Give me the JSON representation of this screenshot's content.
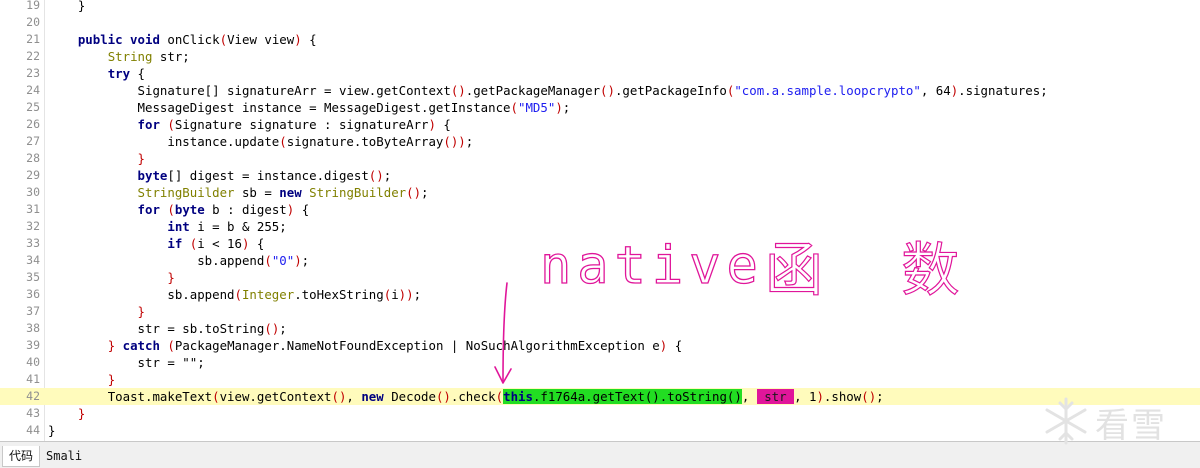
{
  "editor": {
    "lines": [
      {
        "n": "19",
        "indent": "    ",
        "tokens": [
          {
            "t": "}"
          }
        ]
      },
      {
        "n": "20",
        "indent": "",
        "tokens": []
      },
      {
        "n": "21",
        "indent": "    ",
        "tokens": [
          {
            "t": "public void",
            "c": "kw"
          },
          {
            "t": " onClick"
          },
          {
            "t": "(",
            "c": "br"
          },
          {
            "t": "View view"
          },
          {
            "t": ")",
            "c": "br"
          },
          {
            "t": " {"
          }
        ]
      },
      {
        "n": "22",
        "indent": "        ",
        "tokens": [
          {
            "t": "String",
            "c": "ty"
          },
          {
            "t": " str;"
          }
        ]
      },
      {
        "n": "23",
        "indent": "        ",
        "tokens": [
          {
            "t": "try",
            "c": "kw"
          },
          {
            "t": " {"
          }
        ]
      },
      {
        "n": "24",
        "indent": "            ",
        "tokens": [
          {
            "t": "Signature[] signatureArr = view.getContext"
          },
          {
            "t": "()",
            "c": "br"
          },
          {
            "t": ".getPackageManager"
          },
          {
            "t": "()",
            "c": "br"
          },
          {
            "t": ".getPackageInfo"
          },
          {
            "t": "(",
            "c": "br"
          },
          {
            "t": "\"com.a.sample.loopcrypto\"",
            "c": "st"
          },
          {
            "t": ", 64"
          },
          {
            "t": ")",
            "c": "br"
          },
          {
            "t": ".signatures;"
          }
        ]
      },
      {
        "n": "25",
        "indent": "            ",
        "tokens": [
          {
            "t": "MessageDigest instance = MessageDigest.getInstance"
          },
          {
            "t": "(",
            "c": "br"
          },
          {
            "t": "\"MD5\"",
            "c": "st"
          },
          {
            "t": ")",
            "c": "br"
          },
          {
            "t": ";"
          }
        ]
      },
      {
        "n": "26",
        "indent": "            ",
        "tokens": [
          {
            "t": "for",
            "c": "kw"
          },
          {
            "t": " "
          },
          {
            "t": "(",
            "c": "br"
          },
          {
            "t": "Signature signature : signatureArr"
          },
          {
            "t": ")",
            "c": "br"
          },
          {
            "t": " {"
          }
        ]
      },
      {
        "n": "27",
        "indent": "                ",
        "tokens": [
          {
            "t": "instance.update"
          },
          {
            "t": "(",
            "c": "br"
          },
          {
            "t": "signature.toByteArray"
          },
          {
            "t": "())",
            "c": "br"
          },
          {
            "t": ";"
          }
        ]
      },
      {
        "n": "28",
        "indent": "            ",
        "tokens": [
          {
            "t": "}",
            "c": "br"
          }
        ]
      },
      {
        "n": "29",
        "indent": "            ",
        "tokens": [
          {
            "t": "byte",
            "c": "kw"
          },
          {
            "t": "[] digest = instance.digest"
          },
          {
            "t": "()",
            "c": "br"
          },
          {
            "t": ";"
          }
        ]
      },
      {
        "n": "30",
        "indent": "            ",
        "tokens": [
          {
            "t": "StringBuilder",
            "c": "ty"
          },
          {
            "t": " sb = "
          },
          {
            "t": "new",
            "c": "kw"
          },
          {
            "t": " "
          },
          {
            "t": "StringBuilder",
            "c": "ty"
          },
          {
            "t": "()",
            "c": "br"
          },
          {
            "t": ";"
          }
        ]
      },
      {
        "n": "31",
        "indent": "            ",
        "tokens": [
          {
            "t": "for",
            "c": "kw"
          },
          {
            "t": " "
          },
          {
            "t": "(",
            "c": "br"
          },
          {
            "t": "byte",
            "c": "kw"
          },
          {
            "t": " b : digest"
          },
          {
            "t": ")",
            "c": "br"
          },
          {
            "t": " {"
          }
        ]
      },
      {
        "n": "32",
        "indent": "                ",
        "tokens": [
          {
            "t": "int",
            "c": "kw"
          },
          {
            "t": " i = b & 255;"
          }
        ]
      },
      {
        "n": "33",
        "indent": "                ",
        "tokens": [
          {
            "t": "if",
            "c": "kw"
          },
          {
            "t": " "
          },
          {
            "t": "(",
            "c": "br"
          },
          {
            "t": "i < 16"
          },
          {
            "t": ")",
            "c": "br"
          },
          {
            "t": " {"
          }
        ]
      },
      {
        "n": "34",
        "indent": "                    ",
        "tokens": [
          {
            "t": "sb.append"
          },
          {
            "t": "(",
            "c": "br"
          },
          {
            "t": "\"0\"",
            "c": "st"
          },
          {
            "t": ")",
            "c": "br"
          },
          {
            "t": ";"
          }
        ]
      },
      {
        "n": "35",
        "indent": "                ",
        "tokens": [
          {
            "t": "}",
            "c": "br"
          }
        ]
      },
      {
        "n": "36",
        "indent": "                ",
        "tokens": [
          {
            "t": "sb.append"
          },
          {
            "t": "(",
            "c": "br"
          },
          {
            "t": "Integer",
            "c": "ty"
          },
          {
            "t": ".toHexString"
          },
          {
            "t": "(",
            "c": "br"
          },
          {
            "t": "i"
          },
          {
            "t": "))",
            "c": "br"
          },
          {
            "t": ";"
          }
        ]
      },
      {
        "n": "37",
        "indent": "            ",
        "tokens": [
          {
            "t": "}",
            "c": "br"
          }
        ]
      },
      {
        "n": "38",
        "indent": "            ",
        "tokens": [
          {
            "t": "str = sb.toString"
          },
          {
            "t": "()",
            "c": "br"
          },
          {
            "t": ";"
          }
        ]
      },
      {
        "n": "39",
        "indent": "        ",
        "tokens": [
          {
            "t": "}",
            "c": "br"
          },
          {
            "t": " "
          },
          {
            "t": "catch",
            "c": "kw"
          },
          {
            "t": " "
          },
          {
            "t": "(",
            "c": "br"
          },
          {
            "t": "PackageManager.NameNotFoundException | NoSuchAlgorithmException e"
          },
          {
            "t": ")",
            "c": "br"
          },
          {
            "t": " {"
          }
        ]
      },
      {
        "n": "40",
        "indent": "            ",
        "tokens": [
          {
            "t": "str = \"\";"
          }
        ]
      },
      {
        "n": "41",
        "indent": "        ",
        "tokens": [
          {
            "t": "}",
            "c": "br"
          }
        ]
      },
      {
        "n": "42",
        "indent": "        ",
        "highlight": true,
        "tokens": [
          {
            "t": "Toast.makeText"
          },
          {
            "t": "(",
            "c": "br"
          },
          {
            "t": "view.getContext"
          },
          {
            "t": "()",
            "c": "br"
          },
          {
            "t": ", "
          },
          {
            "t": "new",
            "c": "kw"
          },
          {
            "t": " Decode"
          },
          {
            "t": "()",
            "c": "br"
          },
          {
            "t": ".check"
          },
          {
            "t": "(",
            "c": "br"
          },
          {
            "t": "this",
            "c": "kw",
            "m": "mk-green"
          },
          {
            "t": ".f1764a.getText().toString()",
            "m": "mk-green"
          },
          {
            "t": ", "
          },
          {
            "t": " str ",
            "m": "mk-pink"
          },
          {
            "t": ", 1"
          },
          {
            "t": ")",
            "c": "br"
          },
          {
            "t": ".show"
          },
          {
            "t": "()",
            "c": "br"
          },
          {
            "t": ";"
          }
        ]
      },
      {
        "n": "43",
        "indent": "    ",
        "tokens": [
          {
            "t": "}",
            "c": "br"
          }
        ]
      },
      {
        "n": "44",
        "indent": "",
        "tokens": [
          {
            "t": "}"
          }
        ]
      }
    ]
  },
  "annotation": {
    "text_latin": "native",
    "text_cjk": "函 数",
    "ink_color": "#e0169a"
  },
  "tabs": [
    {
      "label": "代码",
      "active": true
    },
    {
      "label": "Smali",
      "active": false
    }
  ],
  "watermark": {
    "text": "看雪",
    "icon": "snowflake-icon"
  }
}
